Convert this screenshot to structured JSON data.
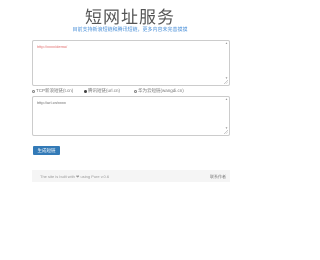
{
  "header": {
    "title": "短网址服务",
    "subtitle": "目前支持新浪短链和腾讯短链，更多内容未完善摸摸"
  },
  "input_area": {
    "value": "http://xxxx/demo/"
  },
  "options": [
    {
      "label": "TCP新浪短链(t.cn)",
      "selected": false
    },
    {
      "label": "腾讯短链(url.cn)",
      "selected": true
    },
    {
      "label": "华为云短链(wangdi.cn)",
      "selected": false
    }
  ],
  "output_area": {
    "value": "http://url.cn/xxxx"
  },
  "actions": {
    "generate_label": "生成短链"
  },
  "footer": {
    "left_text": "The site is built with ❤ using Pure v.0.6",
    "right_text": "联系作者"
  }
}
